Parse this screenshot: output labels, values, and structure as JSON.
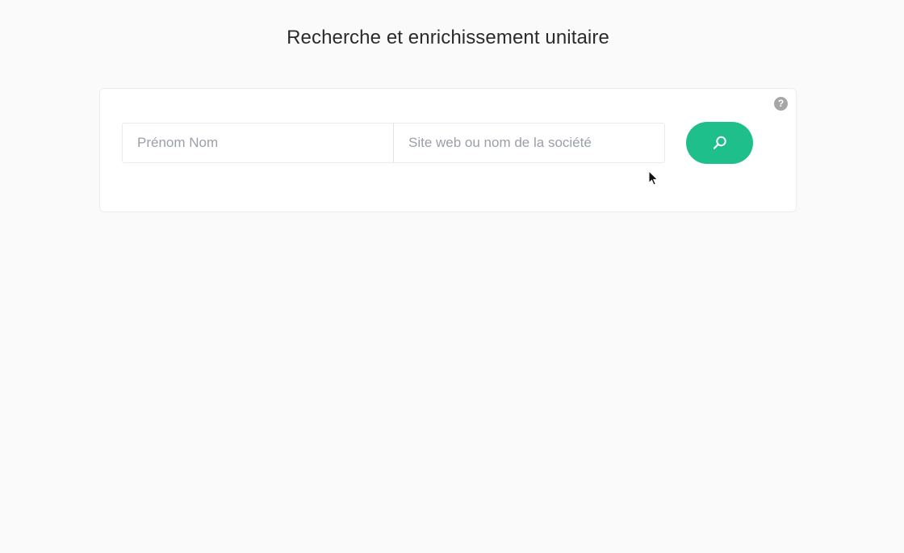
{
  "header": {
    "title": "Recherche et enrichissement unitaire"
  },
  "search": {
    "name_placeholder": "Prénom Nom",
    "name_value": "",
    "company_placeholder": "Site web ou nom de la société",
    "company_value": "",
    "help_label": "?",
    "button_icon": "search-icon"
  },
  "colors": {
    "accent": "#1fbf8c",
    "background": "#fafafa",
    "card": "#ffffff",
    "help_icon": "#a6a6a6"
  }
}
